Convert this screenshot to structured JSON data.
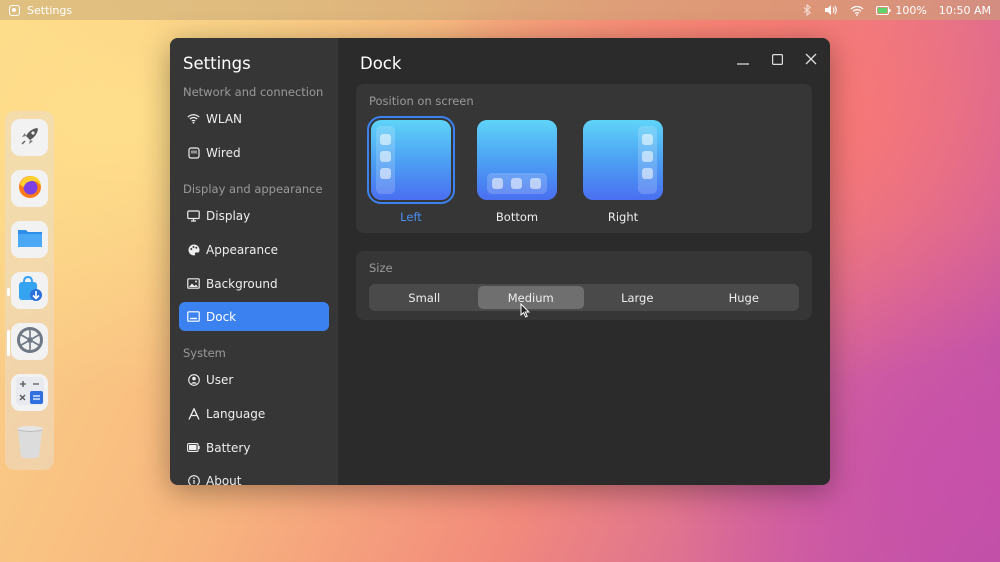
{
  "topbar": {
    "app_name": "Settings",
    "battery": "100%",
    "time": "10:50 AM"
  },
  "dock": {
    "items": [
      {
        "name": "launcher",
        "icon": "rocket-icon"
      },
      {
        "name": "firefox",
        "icon": "firefox-icon"
      },
      {
        "name": "files",
        "icon": "folder-icon"
      },
      {
        "name": "app-store",
        "icon": "store-icon"
      },
      {
        "name": "settings",
        "icon": "gear-icon"
      },
      {
        "name": "calculator",
        "icon": "calculator-icon"
      },
      {
        "name": "trash",
        "icon": "trash-icon"
      }
    ]
  },
  "sidebar": {
    "title": "Settings",
    "sections": [
      {
        "label": "Network and connection",
        "items": [
          {
            "label": "WLAN",
            "icon": "wifi-icon"
          },
          {
            "label": "Wired",
            "icon": "ethernet-icon"
          }
        ]
      },
      {
        "label": "Display and appearance",
        "items": [
          {
            "label": "Display",
            "icon": "monitor-icon"
          },
          {
            "label": "Appearance",
            "icon": "palette-icon"
          },
          {
            "label": "Background",
            "icon": "image-icon"
          },
          {
            "label": "Dock",
            "icon": "dock-icon"
          }
        ]
      },
      {
        "label": "System",
        "items": [
          {
            "label": "User",
            "icon": "user-icon"
          },
          {
            "label": "Language",
            "icon": "language-icon"
          },
          {
            "label": "Battery",
            "icon": "battery-icon"
          },
          {
            "label": "About",
            "icon": "info-icon"
          }
        ]
      }
    ],
    "active_item": "Dock"
  },
  "main": {
    "heading": "Dock",
    "position": {
      "label": "Position on screen",
      "options": [
        {
          "label": "Left"
        },
        {
          "label": "Bottom"
        },
        {
          "label": "Right"
        }
      ],
      "selected": "Left"
    },
    "size": {
      "label": "Size",
      "options": [
        {
          "label": "Small"
        },
        {
          "label": "Medium"
        },
        {
          "label": "Large"
        },
        {
          "label": "Huge"
        }
      ],
      "selected": "Medium"
    }
  },
  "colors": {
    "accent": "#3b82f0",
    "window_bg": "#2b2b2b",
    "sidebar_bg": "#363636",
    "card_bg": "#363636"
  }
}
